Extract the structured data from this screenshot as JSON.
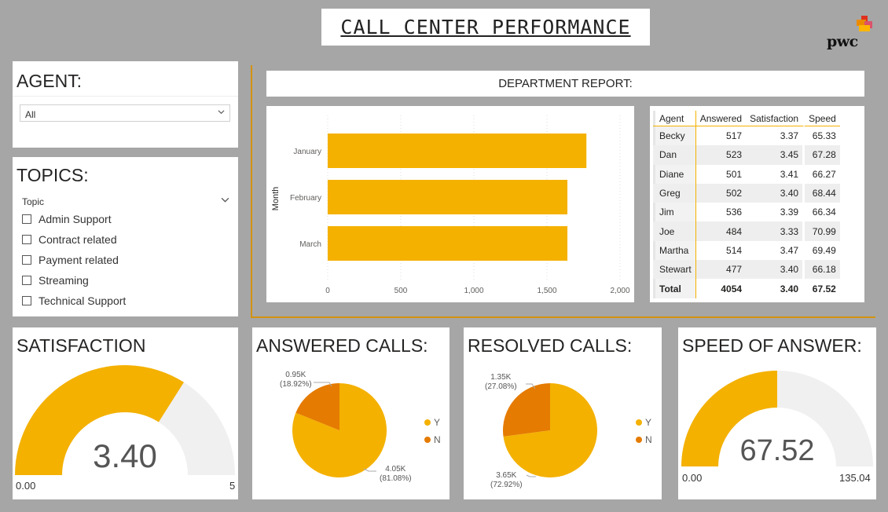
{
  "header": {
    "title": "CALL CENTER PERFORMANCE",
    "logo_text": "pwc"
  },
  "agent_filter": {
    "heading": "AGENT:",
    "selected": "All"
  },
  "topics_filter": {
    "heading": "TOPICS:",
    "field_label": "Topic",
    "items": [
      "Admin Support",
      "Contract related",
      "Payment related",
      "Streaming",
      "Technical Support"
    ]
  },
  "department": {
    "header": "DEPARTMENT REPORT:"
  },
  "chart_data": [
    {
      "type": "bar",
      "orientation": "horizontal",
      "categories": [
        "January",
        "February",
        "March"
      ],
      "values": [
        1770,
        1640,
        1640
      ],
      "xlabel": "",
      "ylabel": "Month",
      "xlim": [
        0,
        2000
      ],
      "xticks": [
        "0",
        "500",
        "1,000",
        "1,500",
        "2,000"
      ],
      "color": "#f4b100",
      "grid": true
    },
    {
      "type": "pie",
      "title": "ANSWERED CALLS:",
      "slices": [
        {
          "name": "Y",
          "value": 4054,
          "label": "4.05K",
          "percent": "(81.08%)",
          "color": "#f4b100"
        },
        {
          "name": "N",
          "value": 946,
          "label": "0.95K",
          "percent": "(18.92%)",
          "color": "#e57b00"
        }
      ]
    },
    {
      "type": "pie",
      "title": "RESOLVED CALLS:",
      "slices": [
        {
          "name": "Y",
          "value": 3646,
          "label": "3.65K",
          "percent": "(72.92%)",
          "color": "#f4b100"
        },
        {
          "name": "N",
          "value": 1354,
          "label": "1.35K",
          "percent": "(27.08%)",
          "color": "#e57b00"
        }
      ]
    }
  ],
  "table": {
    "headers": [
      "Agent",
      "Answered",
      "Satisfaction",
      "Speed"
    ],
    "rows": [
      [
        "Becky",
        "517",
        "3.37",
        "65.33"
      ],
      [
        "Dan",
        "523",
        "3.45",
        "67.28"
      ],
      [
        "Diane",
        "501",
        "3.41",
        "66.27"
      ],
      [
        "Greg",
        "502",
        "3.40",
        "68.44"
      ],
      [
        "Jim",
        "536",
        "3.39",
        "66.34"
      ],
      [
        "Joe",
        "484",
        "3.33",
        "70.99"
      ],
      [
        "Martha",
        "514",
        "3.47",
        "69.49"
      ],
      [
        "Stewart",
        "477",
        "3.40",
        "66.18"
      ]
    ],
    "total": [
      "Total",
      "4054",
      "3.40",
      "67.52"
    ]
  },
  "satisfaction": {
    "heading": "SATISFACTION",
    "value": 3.4,
    "value_text": "3.40",
    "min": "0.00",
    "max": "5",
    "min_value": 0,
    "max_value": 5
  },
  "answered_calls": {
    "legend": [
      "Y",
      "N"
    ]
  },
  "resolved_calls": {
    "legend": [
      "Y",
      "N"
    ]
  },
  "speed": {
    "heading": "SPEED OF ANSWER:",
    "value": 67.52,
    "value_text": "67.52",
    "min": "0.00",
    "max": "135.04",
    "min_value": 0,
    "max_value": 135.04
  },
  "colors": {
    "accent": "#f4b100",
    "secondary": "#e57b00",
    "track": "#f0f0f0",
    "frame": "#d3930f",
    "background": "#a6a6a6"
  }
}
